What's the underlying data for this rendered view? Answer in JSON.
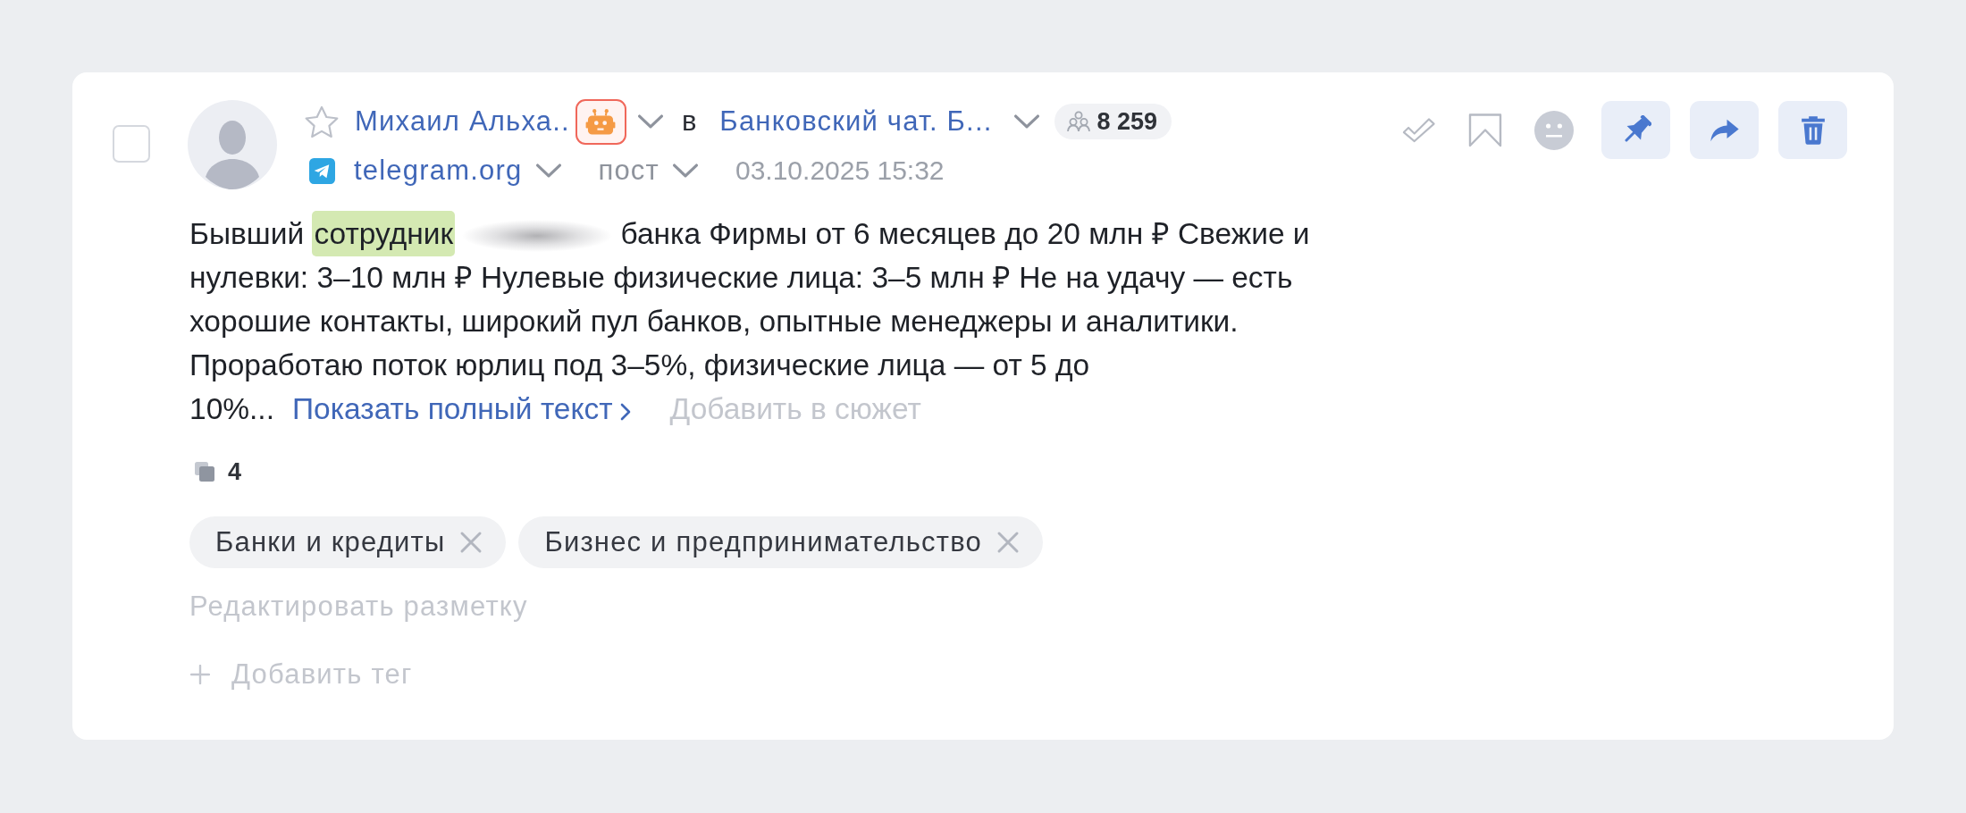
{
  "post": {
    "checked": false,
    "author": {
      "name": "Михаил Альха..",
      "starred": false,
      "bot": true
    },
    "in_label": "в",
    "channel": {
      "name": "Банковский чат. Б...",
      "members": "8 259"
    },
    "source": "telegram.org",
    "type": "пост",
    "date": "03.10.2025 15:32",
    "actions": [
      {
        "kind": "check"
      },
      {
        "kind": "bookmark"
      },
      {
        "kind": "sentiment"
      },
      {
        "kind": "pin"
      },
      {
        "kind": "share"
      },
      {
        "kind": "delete"
      }
    ],
    "text": [
      {
        "kind": "plain",
        "text": "Бывший "
      },
      {
        "kind": "highlight",
        "text": "сотрудник"
      },
      {
        "kind": "redacted"
      },
      {
        "kind": "plain",
        "text": " банка Фирмы от 6 месяцев до 20 млн ₽ Свежие и нулевки: 3–10 млн ₽ Нулевые физические лица: 3–5 млн ₽ Не на удачу — есть хорошие контакты, широкий пул банков, опытные менеджеры и аналитики. Проработаю поток юрлиц под 3–5%, физические лица — от 5 до 10%..."
      }
    ],
    "show_more": "Показать полный текст",
    "add_to_story": "Добавить в сюжет",
    "duplicates": "4",
    "tags": [
      "Банки и кредиты",
      "Бизнес и предпринимательство"
    ],
    "edit_markup": "Редактировать разметку",
    "add_tag": "Добавить тег"
  }
}
